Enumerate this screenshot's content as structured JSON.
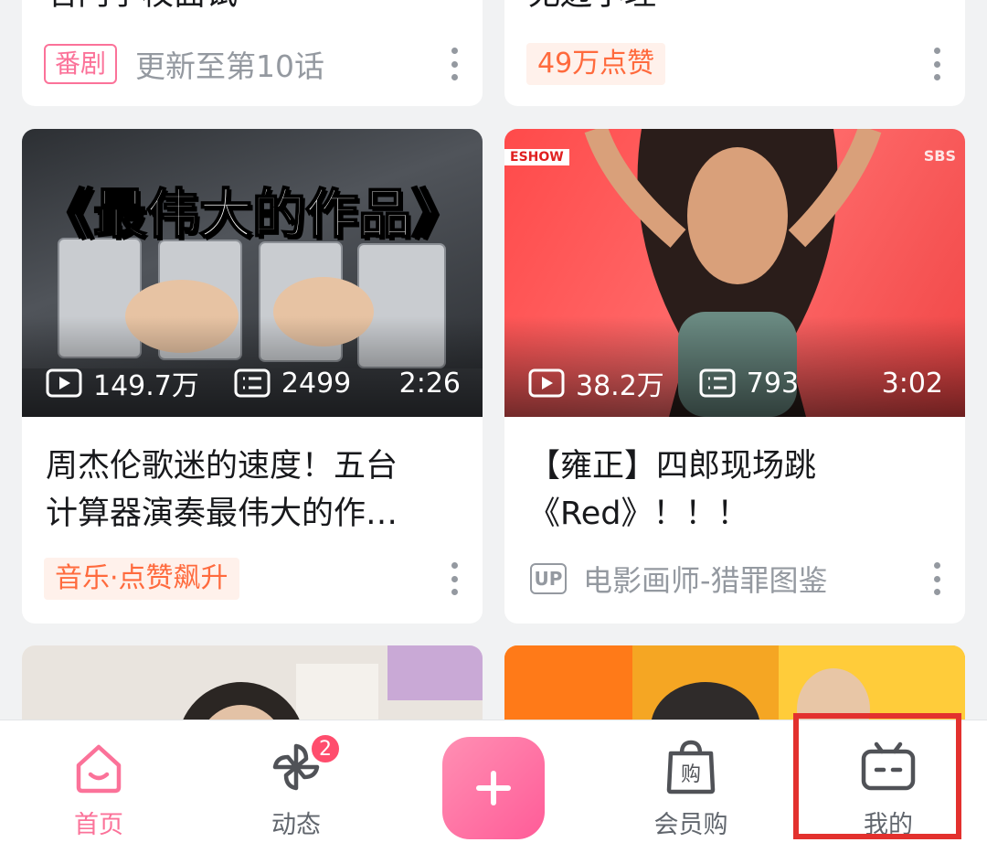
{
  "top_cards": {
    "left": {
      "title_partial": "名门学校面试",
      "tag": "番剧",
      "meta": "更新至第10话"
    },
    "right": {
      "title_partial": "无边小理",
      "tag": "49万点赞"
    }
  },
  "cards": [
    {
      "cover_text": "《最伟大的作品》",
      "views": "149.7万",
      "danmaku": "2499",
      "duration": "2:26",
      "title_line1": "周杰伦歌迷的速度！五台",
      "title_line2": "计算器演奏最伟大的作…",
      "tag": "音乐·点赞飙升"
    },
    {
      "cover_corner_left": "ESHOW",
      "cover_corner_right": "SBS",
      "views": "38.2万",
      "danmaku": "793",
      "duration": "3:02",
      "title_line1": "【雍正】四郎现场跳",
      "title_line2": "《Red》！！！",
      "up_badge": "UP",
      "up_name": "电影画师-猎罪图鉴"
    }
  ],
  "bottom_nav": {
    "items": [
      {
        "label": "首页",
        "icon": "home-tv-icon",
        "active": true
      },
      {
        "label": "动态",
        "icon": "pinwheel-icon",
        "badge": "2"
      },
      {
        "label": "",
        "icon": "plus-icon"
      },
      {
        "label": "会员购",
        "icon": "shopping-bag-icon"
      },
      {
        "label": "我的",
        "icon": "bilibili-tv-icon"
      }
    ]
  },
  "colors": {
    "accent": "#fb7299",
    "tag_orange": "#ff6a3d",
    "highlight": "#e3312e"
  }
}
